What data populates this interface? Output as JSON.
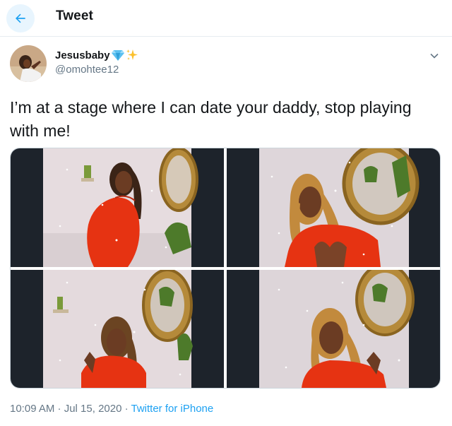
{
  "header": {
    "title": "Tweet",
    "back_icon": "arrow-left-icon"
  },
  "tweet": {
    "author": {
      "display_name": "Jesusbaby",
      "emoji": [
        "gem-icon",
        "sparkles-icon"
      ],
      "handle": "@omohtee12"
    },
    "text": "I’m at a stage where I can date your daddy, stop playing with me!",
    "media_count": 4,
    "timestamp": "10:09 AM · Jul 15, 2020 · ",
    "source": "Twitter for iPhone"
  },
  "colors": {
    "accent": "#1da1f2",
    "muted": "#657786",
    "back_bg": "#e8f5fe",
    "dress": "#e63312"
  }
}
